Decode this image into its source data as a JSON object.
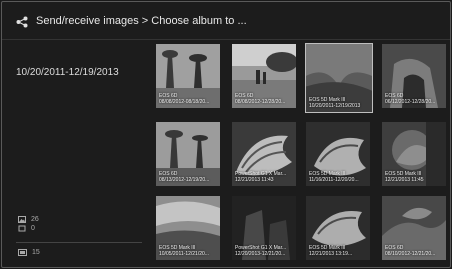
{
  "header": {
    "icon": "share-icon",
    "title": "Send/receive images > Choose album to ..."
  },
  "left_panel": {
    "date_range": "10/20/2011-12/19/2013",
    "stats": [
      {
        "icon": "photo-icon",
        "value": "26"
      },
      {
        "icon": "movie-icon",
        "value": "0"
      },
      {
        "icon": "album-count-icon",
        "value": "15"
      }
    ]
  },
  "albums": [
    {
      "camera": "EOS 6D",
      "dates": "08/08/2012-08/18/20..."
    },
    {
      "camera": "EOS 6D",
      "dates": "08/08/2012-12/28/20..."
    },
    {
      "camera": "EOS 5D Mark III",
      "dates": "10/20/2011-12/19/2013",
      "selected": true
    },
    {
      "camera": "EOS 6D",
      "dates": "06/12/2012-12/28/20..."
    },
    {
      "camera": "EOS 6D",
      "dates": "08/13/2012-12/19/20..."
    },
    {
      "camera": "PowerShot G1 X Mar...",
      "dates": "12/21/2013 11:43"
    },
    {
      "camera": "EOS 5D Mark III",
      "dates": "11/16/2011-12/20/20..."
    },
    {
      "camera": "EOS 5D Mark III",
      "dates": "12/21/2013 11:45"
    },
    {
      "camera": "EOS 5D Mark III",
      "dates": "10/05/2011-12/21/20..."
    },
    {
      "camera": "PowerShot G1 X Mar...",
      "dates": "12/20/2013-12/21/20..."
    },
    {
      "camera": "EOS 5D Mark III",
      "dates": "12/21/2013 13:19..."
    },
    {
      "camera": "EOS 6D",
      "dates": "08/10/2012-12/21/20..."
    }
  ]
}
